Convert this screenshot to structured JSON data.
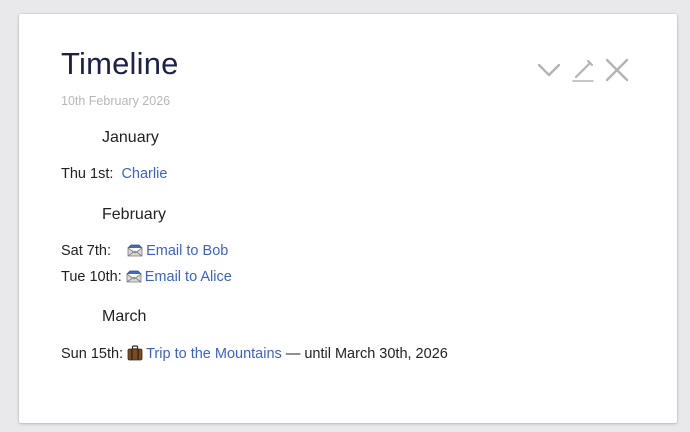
{
  "dialog": {
    "title": "Timeline",
    "date": "10th February 2026"
  },
  "toolbar": {
    "icons": [
      "chevron-down-icon",
      "pencil-icon",
      "close-icon"
    ]
  },
  "months": [
    {
      "name": "January",
      "entries": [
        {
          "day": "Thu 1st:",
          "icon": "",
          "link": "Charlie",
          "suffix": ""
        }
      ]
    },
    {
      "name": "February",
      "entries": [
        {
          "day": "Sat 7th:",
          "icon": "email-icon",
          "link": "Email to Bob",
          "suffix": ""
        },
        {
          "day": "Tue 10th:",
          "icon": "email-icon",
          "link": "Email to Alice",
          "suffix": ""
        }
      ]
    },
    {
      "name": "March",
      "entries": [
        {
          "day": "Sun 15th:",
          "icon": "luggage-icon",
          "link": "Trip to the Mountains",
          "suffix": "— until March 30th, 2026"
        }
      ]
    }
  ]
}
